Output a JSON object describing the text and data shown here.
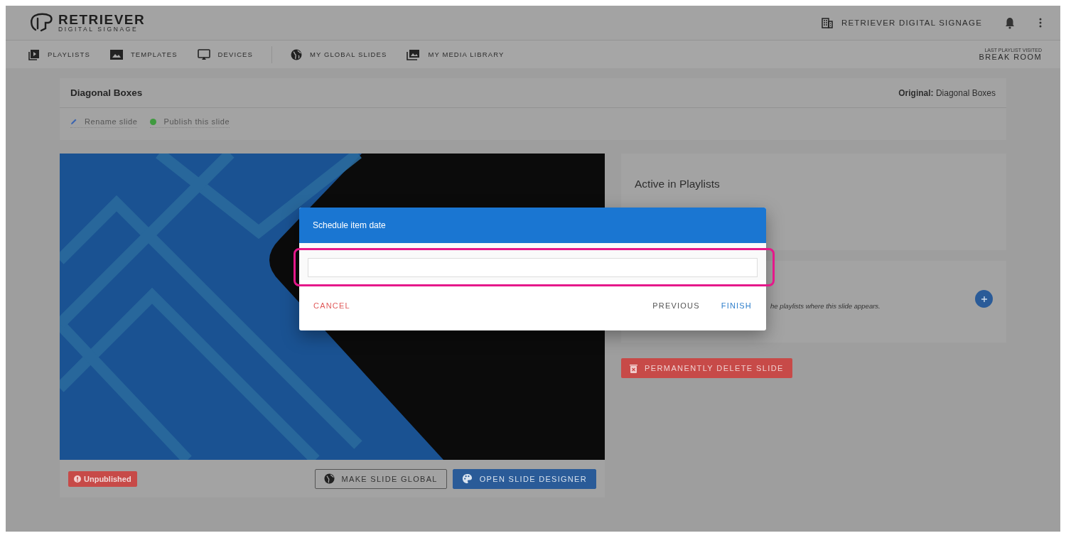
{
  "header": {
    "logo_name": "RETRIEVER",
    "logo_sub": "DIGITAL SIGNAGE",
    "organization": "RETRIEVER DIGITAL SIGNAGE"
  },
  "nav": {
    "primary": [
      {
        "label": "PLAYLISTS",
        "kind": "playlist"
      },
      {
        "label": "TEMPLATES",
        "kind": "image"
      },
      {
        "label": "DEVICES",
        "kind": "cast"
      }
    ],
    "secondary": [
      {
        "label": "MY GLOBAL SLIDES",
        "kind": "globe"
      },
      {
        "label": "MY MEDIA LIBRARY",
        "kind": "library"
      }
    ],
    "last_playlist": {
      "label": "LAST PLAYLIST VISITED",
      "value": "BREAK ROOM"
    }
  },
  "slide": {
    "title": "Diagonal Boxes",
    "original_label": "Original:",
    "original_value": "Diagonal Boxes",
    "actions": [
      {
        "label": "Rename slide",
        "kind": "pencil"
      },
      {
        "label": "Publish this slide",
        "kind": "dot",
        "color": "#3f9a3f"
      }
    ],
    "status": "Unpublished",
    "buttons": [
      {
        "label": "MAKE SLIDE GLOBAL",
        "kind": "outline"
      },
      {
        "label": "OPEN SLIDE DESIGNER",
        "kind": "primary"
      }
    ]
  },
  "side": {
    "active_title": "Active in Playlists",
    "playlists_hint": "he playlists where this slide appears.",
    "delete_label": "PERMANENTLY DELETE SLIDE"
  },
  "dialog": {
    "title": "Schedule item date",
    "buttons": [
      {
        "label": "CANCEL",
        "kind": "danger"
      },
      {
        "label": "PREVIOUS",
        "kind": "plain"
      },
      {
        "label": "FINISH",
        "kind": "primary"
      }
    ]
  }
}
